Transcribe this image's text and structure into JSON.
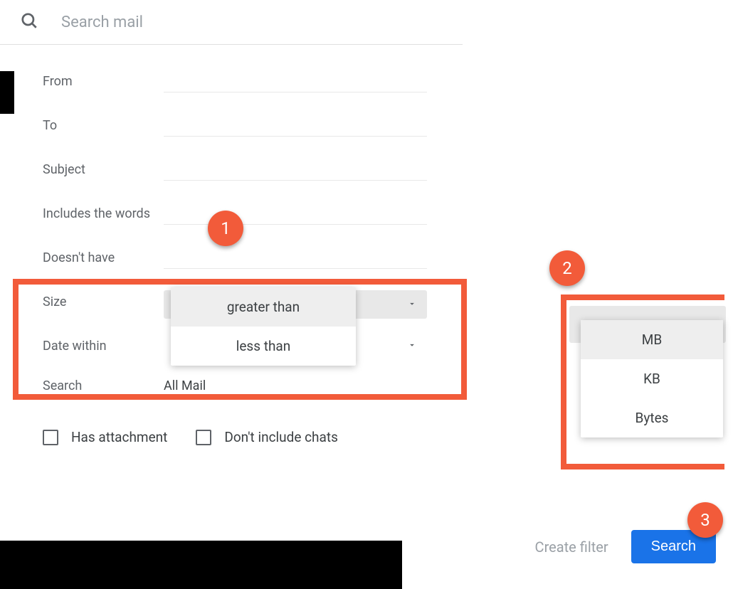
{
  "search": {
    "placeholder": "Search mail"
  },
  "fields": {
    "from": "From",
    "to": "To",
    "subject": "Subject",
    "includes": "Includes the words",
    "doesnt": "Doesn't have",
    "size": "Size",
    "date": "Date within",
    "searchIn": "Search",
    "searchInValue": "All Mail"
  },
  "sizeDropdown": {
    "greater": "greater than",
    "less": "less than"
  },
  "unitDropdown": {
    "mb": "MB",
    "kb": "KB",
    "bytes": "Bytes"
  },
  "checkboxes": {
    "attachment": "Has attachment",
    "chats": "Don't include chats"
  },
  "actions": {
    "createFilter": "Create filter",
    "search": "Search"
  },
  "annotations": {
    "n1": "1",
    "n2": "2",
    "n3": "3"
  }
}
